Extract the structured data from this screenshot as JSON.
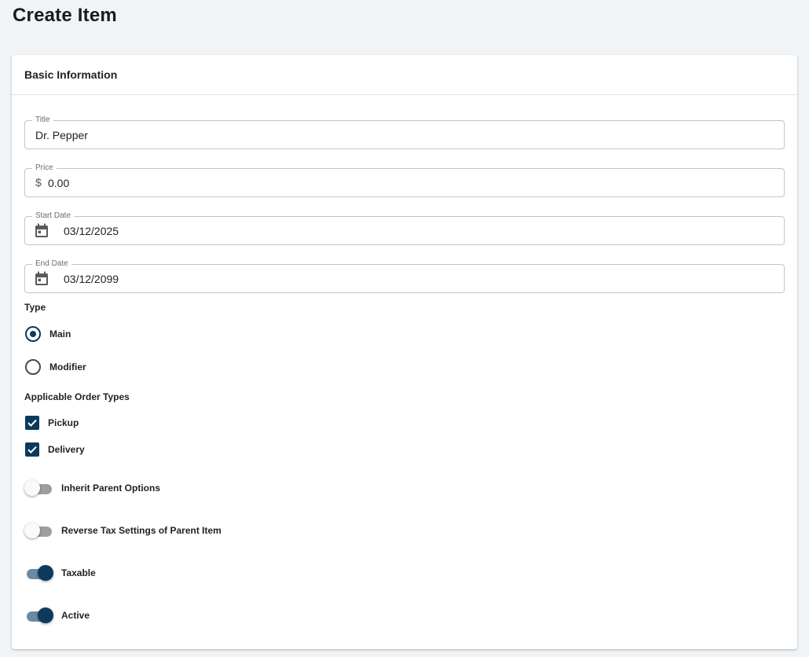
{
  "page": {
    "title": "Create Item"
  },
  "card": {
    "header": "Basic Information"
  },
  "fields": {
    "title": {
      "label": "Title",
      "value": "Dr. Pepper"
    },
    "price": {
      "label": "Price",
      "prefix": "$",
      "value": "0.00"
    },
    "start_date": {
      "label": "Start Date",
      "value": "03/12/2025",
      "icon": "calendar-icon"
    },
    "end_date": {
      "label": "End Date",
      "value": "03/12/2099",
      "icon": "calendar-icon"
    }
  },
  "type": {
    "label": "Type",
    "options": [
      {
        "label": "Main",
        "selected": true
      },
      {
        "label": "Modifier",
        "selected": false
      }
    ]
  },
  "order_types": {
    "label": "Applicable Order Types",
    "options": [
      {
        "label": "Pickup",
        "checked": true
      },
      {
        "label": "Delivery",
        "checked": true
      }
    ]
  },
  "toggles": [
    {
      "label": "Inherit Parent Options",
      "on": false
    },
    {
      "label": "Reverse Tax Settings of Parent Item",
      "on": false
    },
    {
      "label": "Taxable",
      "on": true
    },
    {
      "label": "Active",
      "on": true
    }
  ],
  "colors": {
    "accent": "#0d3a5c",
    "background": "#f1f4f7",
    "card": "#ffffff",
    "switch_off_track": "#9e9e9e",
    "switch_on_track": "#6a8aa3"
  }
}
